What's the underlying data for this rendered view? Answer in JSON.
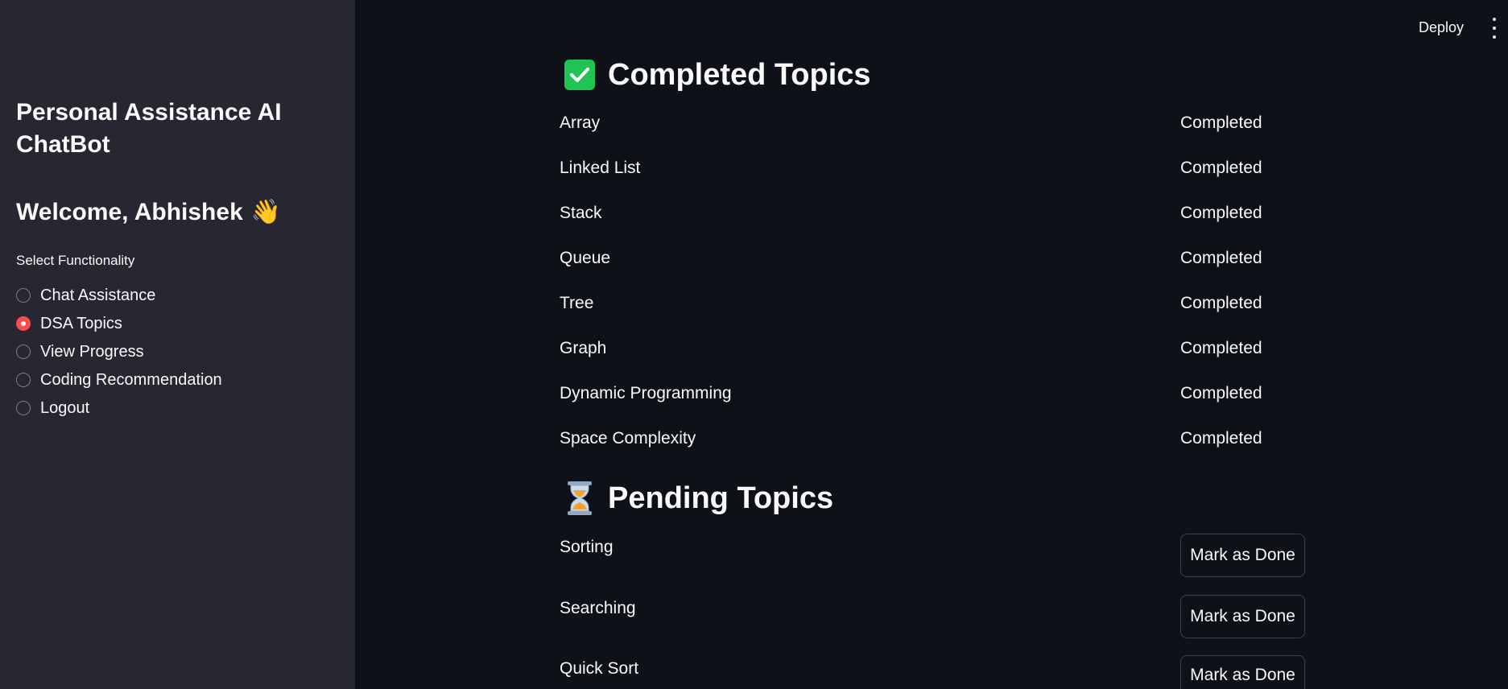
{
  "header": {
    "deploy_label": "Deploy"
  },
  "sidebar": {
    "title": "Personal Assistance AI ChatBot",
    "welcome": "Welcome, Abhishek",
    "welcome_emoji": "👋",
    "radio_label": "Select Functionality",
    "options": [
      {
        "label": "Chat Assistance",
        "selected": false
      },
      {
        "label": "DSA Topics",
        "selected": true
      },
      {
        "label": "View Progress",
        "selected": false
      },
      {
        "label": "Coding Recommendation",
        "selected": false
      },
      {
        "label": "Logout",
        "selected": false
      }
    ]
  },
  "completed": {
    "heading": "Completed Topics",
    "icon": "check-mark-icon",
    "rows": [
      {
        "topic": "Array",
        "status": "Completed"
      },
      {
        "topic": "Linked List",
        "status": "Completed"
      },
      {
        "topic": "Stack",
        "status": "Completed"
      },
      {
        "topic": "Queue",
        "status": "Completed"
      },
      {
        "topic": "Tree",
        "status": "Completed"
      },
      {
        "topic": "Graph",
        "status": "Completed"
      },
      {
        "topic": "Dynamic Programming",
        "status": "Completed"
      },
      {
        "topic": "Space Complexity",
        "status": "Completed"
      }
    ]
  },
  "pending": {
    "heading": "Pending Topics",
    "icon": "hourglass-icon",
    "button_label": "Mark as Done",
    "rows": [
      {
        "topic": "Sorting"
      },
      {
        "topic": "Searching"
      },
      {
        "topic": "Quick Sort"
      }
    ]
  },
  "colors": {
    "sidebar_bg": "#262730",
    "main_bg": "#0e1117",
    "accent": "#ff4b4b",
    "check_green": "#21c354"
  }
}
